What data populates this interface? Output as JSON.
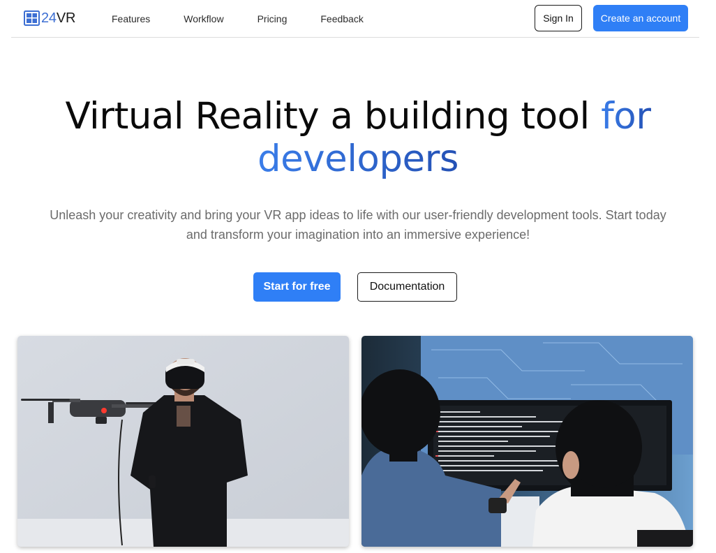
{
  "brand": {
    "num": "24",
    "suffix": "VR"
  },
  "nav": {
    "links": [
      "Features",
      "Workflow",
      "Pricing",
      "Feedback"
    ],
    "signin_label": "Sign In",
    "create_label": "Create an account"
  },
  "hero": {
    "title_main": "Virtual Reality a building tool ",
    "title_accent_1": "for",
    "title_accent_2": "developers",
    "subtitle": "Unleash your creativity and bring your VR app ideas to life with our user-friendly development tools. Start today and transform your imagination into an immersive experience!",
    "primary_cta": "Start for free",
    "secondary_cta": "Documentation"
  },
  "colors": {
    "accent": "#2f7ff6",
    "brand_blue": "#3d6fd3",
    "gradient_start": "#3a7de9",
    "gradient_end": "#2451b5",
    "subtitle_gray": "#6b6b6b"
  },
  "icons": {
    "brand": "grid-window-icon"
  }
}
